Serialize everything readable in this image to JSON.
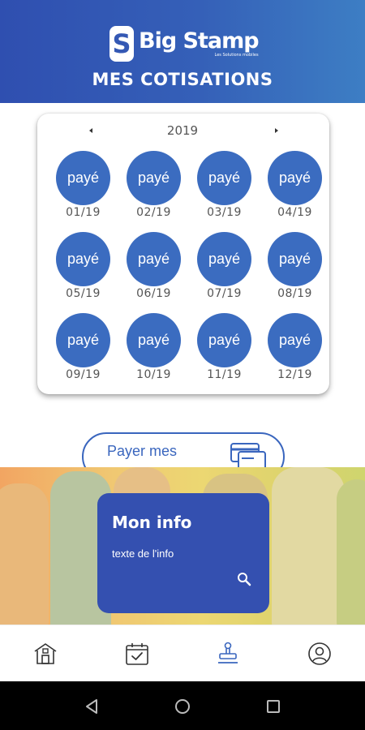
{
  "header": {
    "logo_mark": "S",
    "logo_name": "Big Stamp",
    "logo_tagline": "Les Solutions mobiles",
    "title": "MES COTISATIONS"
  },
  "calendar": {
    "year": "2019",
    "months": [
      {
        "status": "payé",
        "label": "01/19"
      },
      {
        "status": "payé",
        "label": "02/19"
      },
      {
        "status": "payé",
        "label": "03/19"
      },
      {
        "status": "payé",
        "label": "04/19"
      },
      {
        "status": "payé",
        "label": "05/19"
      },
      {
        "status": "payé",
        "label": "06/19"
      },
      {
        "status": "payé",
        "label": "07/19"
      },
      {
        "status": "payé",
        "label": "08/19"
      },
      {
        "status": "payé",
        "label": "09/19"
      },
      {
        "status": "payé",
        "label": "10/19"
      },
      {
        "status": "payé",
        "label": "11/19"
      },
      {
        "status": "payé",
        "label": "12/19"
      }
    ]
  },
  "pay_button": {
    "label": "Payer mes"
  },
  "info": {
    "title": "Mon info",
    "text": "texte de l'info"
  },
  "tabs": {
    "items": [
      {
        "icon": "home-icon"
      },
      {
        "icon": "calendar-check-icon"
      },
      {
        "icon": "stamp-icon",
        "active": true
      },
      {
        "icon": "profile-icon"
      }
    ]
  },
  "colors": {
    "primary": "#3b6cc0",
    "header_start": "#2f4fb0",
    "header_end": "#3d7ec4",
    "info_card": "#3450b0"
  }
}
